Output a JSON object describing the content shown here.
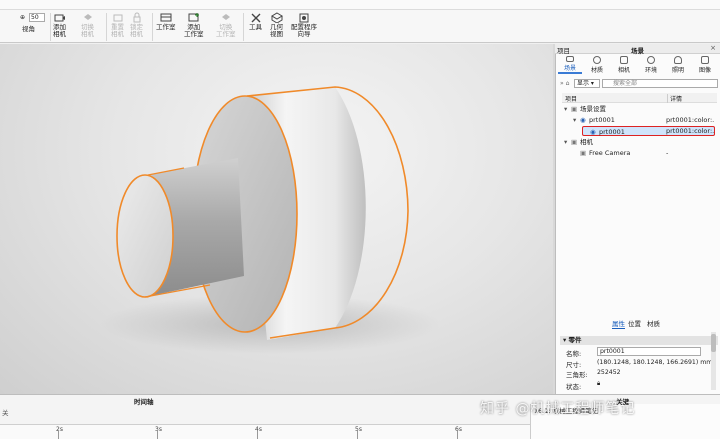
{
  "toolbar": {
    "view_label": "视角",
    "zoom_value": "50",
    "add_camera": "添加\n相机",
    "switch_camera": "切换\n相机",
    "reset_camera": "重置\n相机",
    "lock_camera": "锁定\n相机",
    "studio": "工作室",
    "add_studio": "添加\n工作室",
    "switch_studio": "切换\n工作室",
    "tools": "工具",
    "geometry_view": "几何\n视图",
    "config_wizard": "配置程序\n向导"
  },
  "panel": {
    "title_left": "项目",
    "title_center": "场景",
    "tabs": [
      "场景",
      "材质",
      "相机",
      "环境",
      "照明",
      "图像"
    ],
    "display_select": "显示",
    "search_placeholder": "搜索全部",
    "col_item": "项目",
    "col_detail": "详情",
    "tree": [
      {
        "label": "场景设置",
        "detail": "",
        "indent": 0,
        "toggle": "−",
        "eye": false
      },
      {
        "label": "prt0001",
        "detail": "prt0001:color:...",
        "indent": 1,
        "toggle": "−",
        "eye": true
      },
      {
        "label": "prt0001",
        "detail": "prt0001:color:...",
        "indent": 2,
        "toggle": "",
        "eye": true,
        "selected": true
      },
      {
        "label": "相机",
        "detail": "",
        "indent": 0,
        "toggle": "−",
        "eye": false
      },
      {
        "label": "Free Camera",
        "detail": "-",
        "indent": 1,
        "toggle": "",
        "eye": false
      }
    ],
    "subtabs": [
      "属性",
      "位置",
      "材质"
    ],
    "section": "零件",
    "props": {
      "name_label": "名称:",
      "name_value": "prt0001",
      "size_label": "尺寸:",
      "size_value": "(180.1248, 180.1248, 166.2691) mm",
      "tri_label": "三角形:",
      "tri_value": "252452",
      "state_label": "状态:"
    }
  },
  "timeline": {
    "title": "时间轴",
    "title_right": "关键",
    "left_label": "关",
    "ticks": [
      "2s",
      "3s",
      "4s",
      "5s",
      "6s"
    ],
    "right_text": "16.1: 机械工程师笔记"
  },
  "watermark": "知乎 @机械工程师笔记",
  "colors": {
    "selection_outline": "#f08a2a",
    "highlight_box": "#dd2222",
    "accent": "#3a7bd5"
  }
}
